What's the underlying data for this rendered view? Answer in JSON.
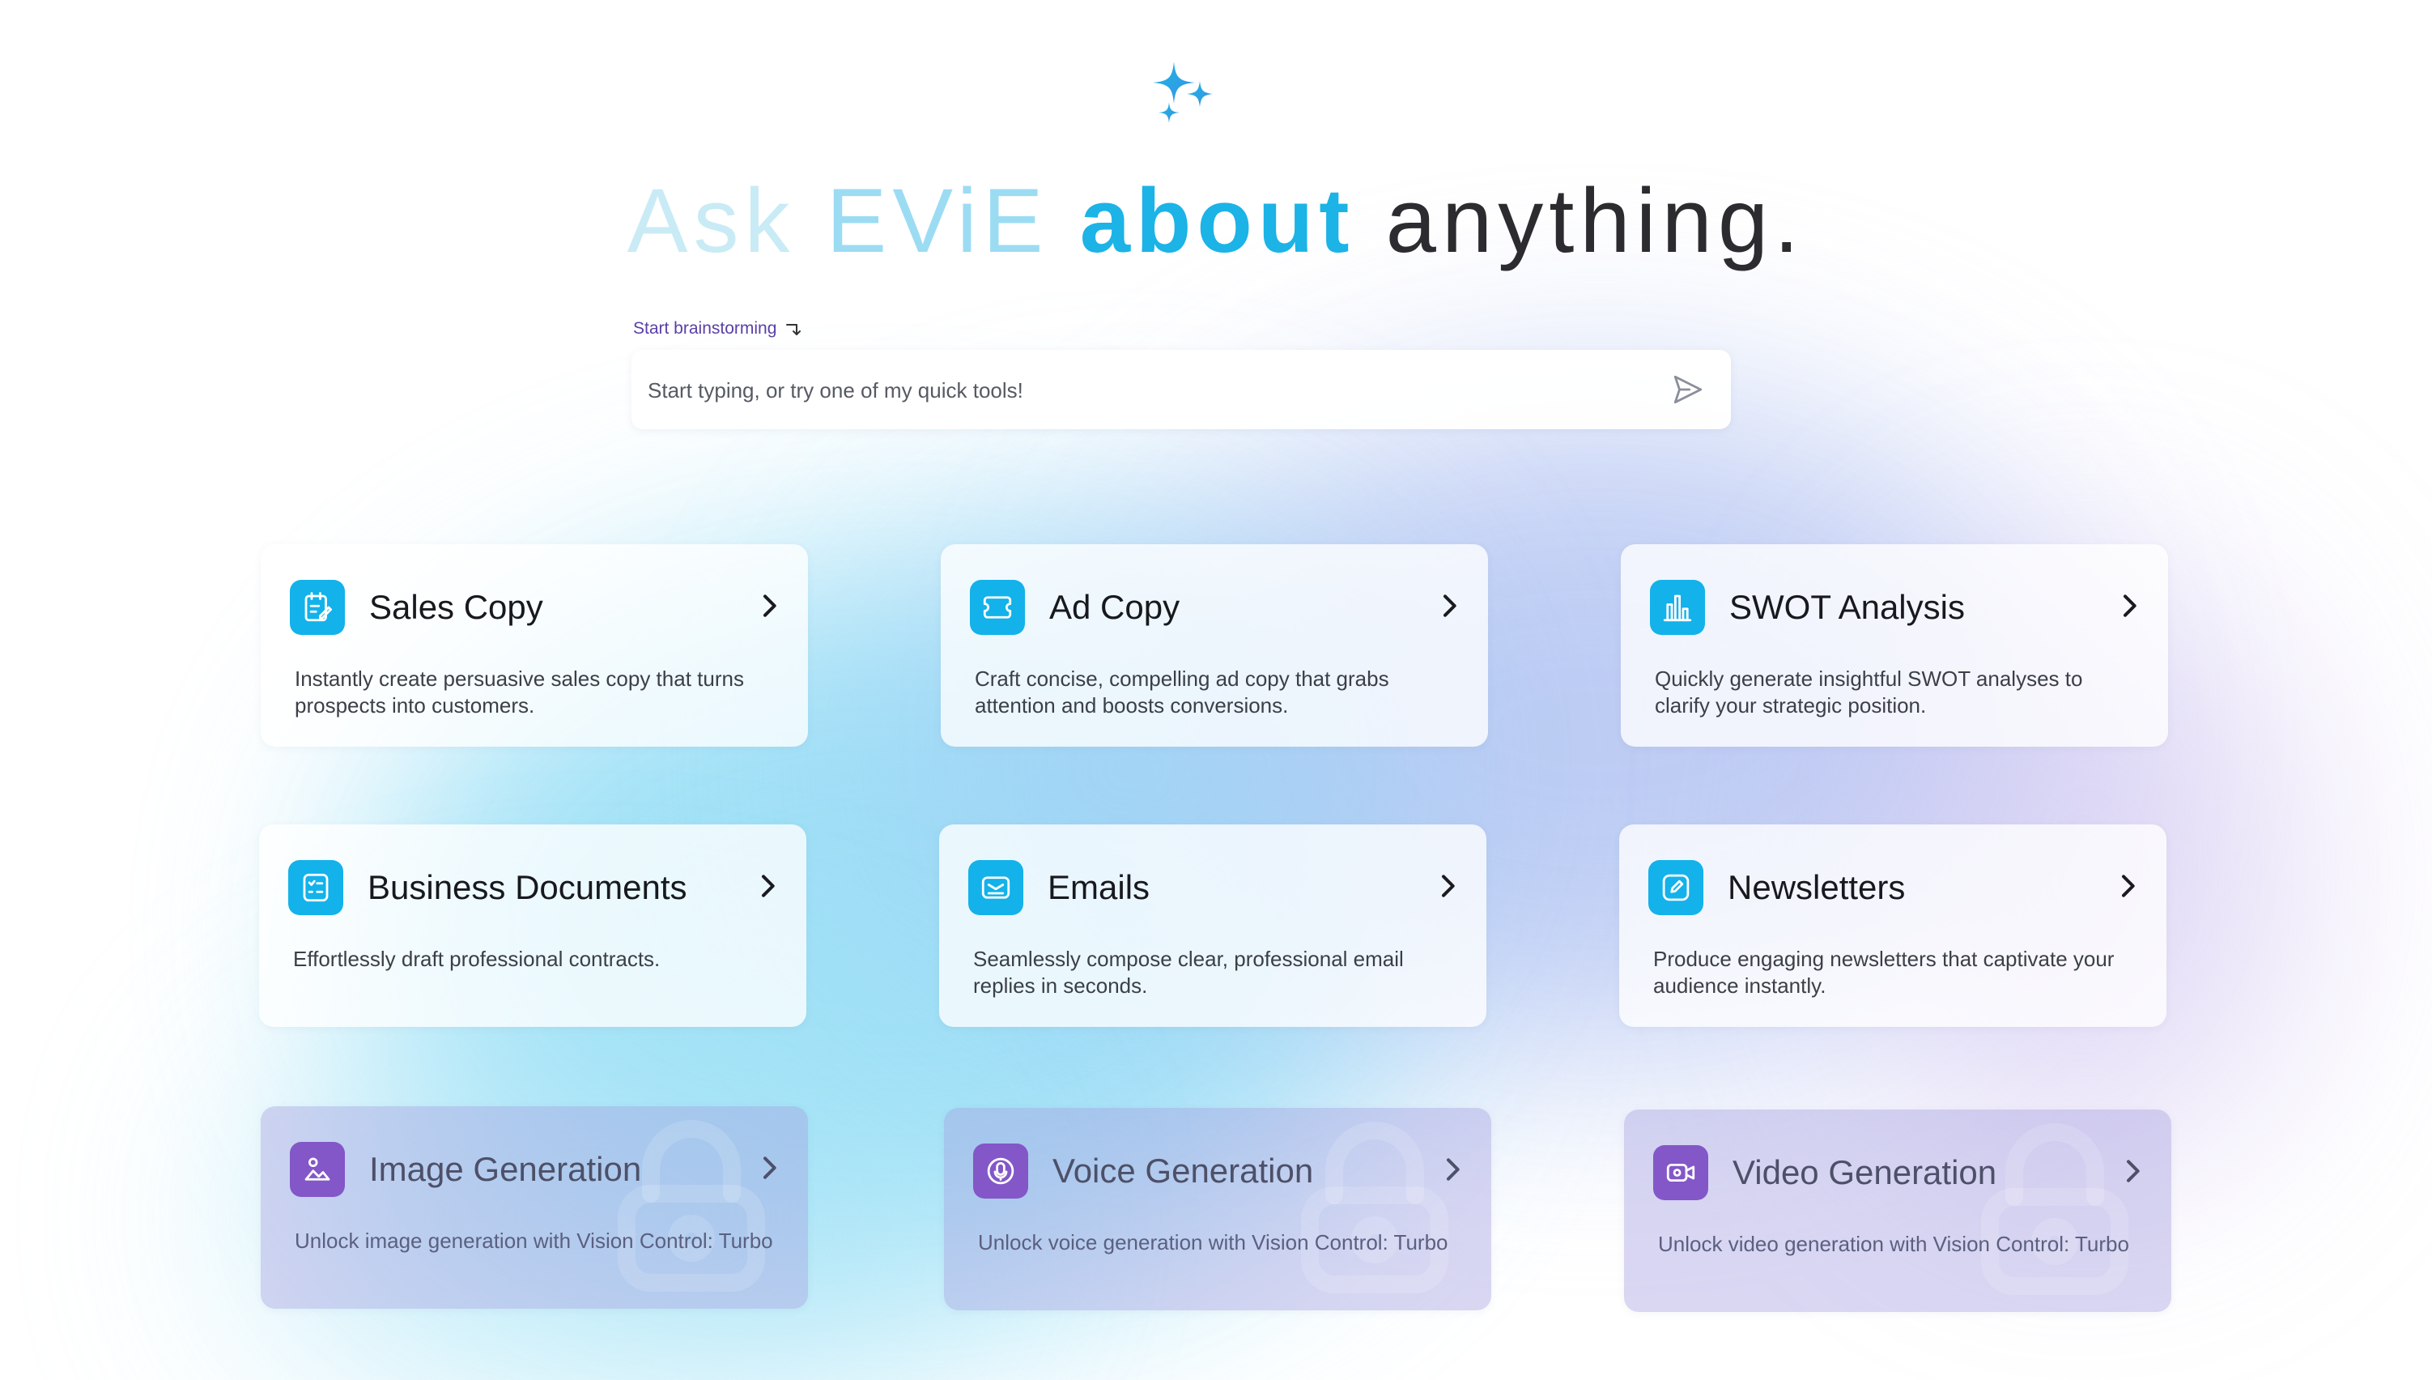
{
  "hero": {
    "words": [
      "Ask",
      "EViE",
      "about",
      "anything."
    ]
  },
  "input": {
    "hint": "Start brainstorming",
    "placeholder": "Start typing, or try one of my quick tools!"
  },
  "cards": [
    {
      "title": "Sales Copy",
      "desc": "Instantly create persuasive sales copy that turns prospects into customers.",
      "icon": "notebook-pen-icon",
      "locked": false
    },
    {
      "title": "Ad Copy",
      "desc": "Craft concise, compelling ad copy that grabs attention and boosts conversions.",
      "icon": "ticket-icon",
      "locked": false
    },
    {
      "title": "SWOT Analysis",
      "desc": "Quickly generate insightful SWOT analyses to clarify your strategic position.",
      "icon": "bar-chart-icon",
      "locked": false
    },
    {
      "title": "Business Documents",
      "desc": "Effortlessly draft professional contracts.",
      "icon": "checklist-icon",
      "locked": false
    },
    {
      "title": "Emails",
      "desc": "Seamlessly compose clear, professional email replies in seconds.",
      "icon": "email-icon",
      "locked": false
    },
    {
      "title": "Newsletters",
      "desc": "Produce engaging newsletters that captivate your audience instantly.",
      "icon": "edit-icon",
      "locked": false
    },
    {
      "title": "Image Generation",
      "desc": "Unlock image generation with Vision Control: Turbo",
      "icon": "image-icon",
      "locked": true
    },
    {
      "title": "Voice Generation",
      "desc": "Unlock voice generation with Vision Control: Turbo",
      "icon": "microphone-icon",
      "locked": true
    },
    {
      "title": "Video Generation",
      "desc": "Unlock video generation with Vision Control: Turbo",
      "icon": "video-icon",
      "locked": true
    }
  ],
  "colors": {
    "accent": "#13b2ea",
    "locked_accent": "#8357c8",
    "hint": "#5a3fa6",
    "heading_dark": "#2c2c30"
  }
}
